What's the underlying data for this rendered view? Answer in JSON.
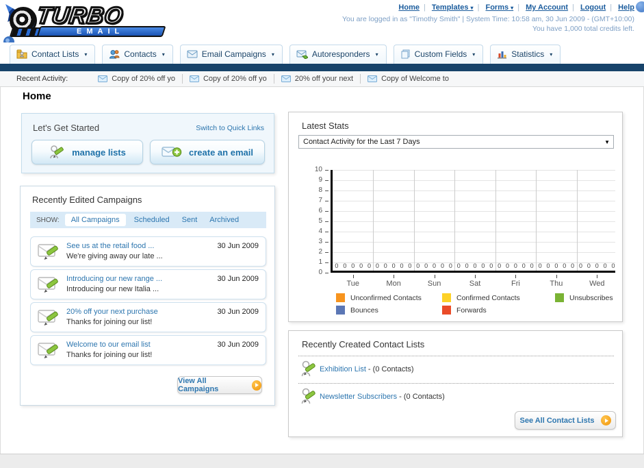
{
  "header": {
    "logo": {
      "title": "TURBO",
      "subtitle": "EMAIL"
    },
    "nav": {
      "items": [
        {
          "label": "Home",
          "dropdown": false
        },
        {
          "label": "Templates",
          "dropdown": true
        },
        {
          "label": "Forms",
          "dropdown": true
        },
        {
          "label": "My Account",
          "dropdown": false
        },
        {
          "label": "Logout",
          "dropdown": false
        },
        {
          "label": "Help",
          "dropdown": false
        }
      ]
    },
    "login_line1": "You are logged in as \"Timothy Smith\" | System Time: 10:58 am, 30 Jun 2009 - (GMT+10:00)",
    "login_line2": "You have 1,000 total credits left."
  },
  "main_tabs": [
    {
      "label": "Contact Lists",
      "icon": "contact-lists-folder-icon"
    },
    {
      "label": "Contacts",
      "icon": "contacts-people-icon"
    },
    {
      "label": "Email Campaigns",
      "icon": "email-envelope-icon"
    },
    {
      "label": "Autoresponders",
      "icon": "autoresponder-envelope-icon"
    },
    {
      "label": "Custom Fields",
      "icon": "custom-fields-pages-icon"
    },
    {
      "label": "Statistics",
      "icon": "statistics-chart-icon"
    }
  ],
  "recent_activity": {
    "label": "Recent Activity:",
    "items": [
      "Copy of 20% off yo",
      "Copy of 20% off yo",
      "20% off your next",
      "Copy of Welcome to"
    ]
  },
  "page_title": "Home",
  "get_started": {
    "title": "Let's Get Started",
    "switch_link": "Switch to Quick Links",
    "manage_lists_label": "manage lists",
    "create_email_label": "create an email"
  },
  "campaigns": {
    "title": "Recently Edited Campaigns",
    "show_label": "SHOW:",
    "filters": [
      "All Campaigns",
      "Scheduled",
      "Sent",
      "Archived"
    ],
    "active_filter": "All Campaigns",
    "items": [
      {
        "title": "See us at the retail food ...",
        "subtitle": "We're giving away our late ...",
        "date": "30 Jun 2009"
      },
      {
        "title": "Introducing our new range ...",
        "subtitle": "Introducing our new Italia ...",
        "date": "30 Jun 2009"
      },
      {
        "title": "20% off your next purchase",
        "subtitle": "Thanks for joining our list!",
        "date": "30 Jun 2009"
      },
      {
        "title": "Welcome to our email list",
        "subtitle": "Thanks for joining our list!",
        "date": "30 Jun 2009"
      }
    ],
    "view_all_label": "View All Campaigns"
  },
  "stats": {
    "title": "Latest Stats",
    "period_selected": "Contact Activity for the Last 7 Days"
  },
  "chart_data": {
    "type": "bar",
    "title": "Contact Activity for the Last 7 Days",
    "categories": [
      "Tue",
      "Mon",
      "Sun",
      "Sat",
      "Fri",
      "Thu",
      "Wed"
    ],
    "series": [
      {
        "name": "Unconfirmed Contacts",
        "color": "#F7941E",
        "values": [
          0,
          0,
          0,
          0,
          0,
          0,
          0
        ]
      },
      {
        "name": "Confirmed Contacts",
        "color": "#FDD127",
        "values": [
          0,
          0,
          0,
          0,
          0,
          0,
          0
        ]
      },
      {
        "name": "Unsubscribes",
        "color": "#7AB334",
        "values": [
          0,
          0,
          0,
          0,
          0,
          0,
          0
        ]
      },
      {
        "name": "Bounces",
        "color": "#5B77B5",
        "values": [
          0,
          0,
          0,
          0,
          0,
          0,
          0
        ]
      },
      {
        "name": "Forwards",
        "color": "#EA4B28",
        "values": [
          0,
          0,
          0,
          0,
          0,
          0,
          0
        ]
      }
    ],
    "ylim": [
      0,
      10
    ],
    "ytick_step": 1,
    "grid": true,
    "legend_position": "bottom"
  },
  "contact_lists": {
    "title": "Recently Created Contact Lists",
    "items": [
      {
        "name": "Exhibition List",
        "detail": " - (0 Contacts)"
      },
      {
        "name": "Newsletter Subscribers",
        "detail": " - (0 Contacts)"
      }
    ],
    "see_all_label": "See All Contact Lists"
  }
}
